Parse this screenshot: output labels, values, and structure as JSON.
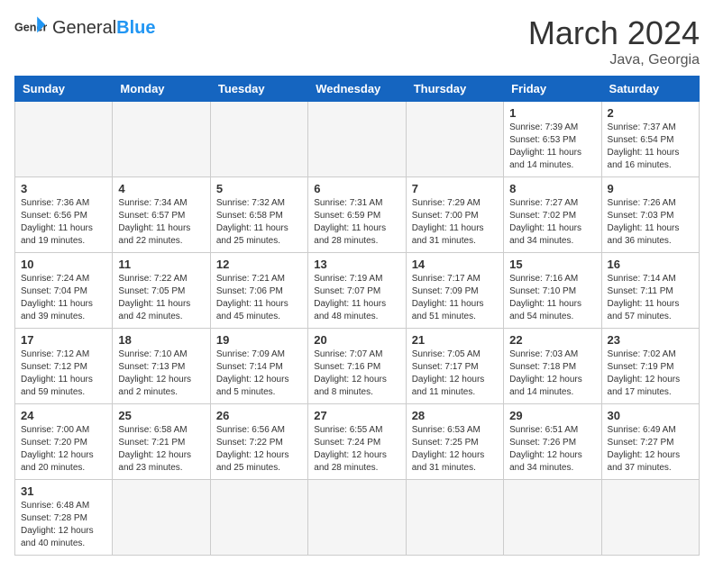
{
  "header": {
    "logo_general": "General",
    "logo_blue": "Blue",
    "title": "March 2024",
    "location": "Java, Georgia"
  },
  "days_of_week": [
    "Sunday",
    "Monday",
    "Tuesday",
    "Wednesday",
    "Thursday",
    "Friday",
    "Saturday"
  ],
  "weeks": [
    [
      {
        "day": "",
        "info": ""
      },
      {
        "day": "",
        "info": ""
      },
      {
        "day": "",
        "info": ""
      },
      {
        "day": "",
        "info": ""
      },
      {
        "day": "",
        "info": ""
      },
      {
        "day": "1",
        "info": "Sunrise: 7:39 AM\nSunset: 6:53 PM\nDaylight: 11 hours and 14 minutes."
      },
      {
        "day": "2",
        "info": "Sunrise: 7:37 AM\nSunset: 6:54 PM\nDaylight: 11 hours and 16 minutes."
      }
    ],
    [
      {
        "day": "3",
        "info": "Sunrise: 7:36 AM\nSunset: 6:56 PM\nDaylight: 11 hours and 19 minutes."
      },
      {
        "day": "4",
        "info": "Sunrise: 7:34 AM\nSunset: 6:57 PM\nDaylight: 11 hours and 22 minutes."
      },
      {
        "day": "5",
        "info": "Sunrise: 7:32 AM\nSunset: 6:58 PM\nDaylight: 11 hours and 25 minutes."
      },
      {
        "day": "6",
        "info": "Sunrise: 7:31 AM\nSunset: 6:59 PM\nDaylight: 11 hours and 28 minutes."
      },
      {
        "day": "7",
        "info": "Sunrise: 7:29 AM\nSunset: 7:00 PM\nDaylight: 11 hours and 31 minutes."
      },
      {
        "day": "8",
        "info": "Sunrise: 7:27 AM\nSunset: 7:02 PM\nDaylight: 11 hours and 34 minutes."
      },
      {
        "day": "9",
        "info": "Sunrise: 7:26 AM\nSunset: 7:03 PM\nDaylight: 11 hours and 36 minutes."
      }
    ],
    [
      {
        "day": "10",
        "info": "Sunrise: 7:24 AM\nSunset: 7:04 PM\nDaylight: 11 hours and 39 minutes."
      },
      {
        "day": "11",
        "info": "Sunrise: 7:22 AM\nSunset: 7:05 PM\nDaylight: 11 hours and 42 minutes."
      },
      {
        "day": "12",
        "info": "Sunrise: 7:21 AM\nSunset: 7:06 PM\nDaylight: 11 hours and 45 minutes."
      },
      {
        "day": "13",
        "info": "Sunrise: 7:19 AM\nSunset: 7:07 PM\nDaylight: 11 hours and 48 minutes."
      },
      {
        "day": "14",
        "info": "Sunrise: 7:17 AM\nSunset: 7:09 PM\nDaylight: 11 hours and 51 minutes."
      },
      {
        "day": "15",
        "info": "Sunrise: 7:16 AM\nSunset: 7:10 PM\nDaylight: 11 hours and 54 minutes."
      },
      {
        "day": "16",
        "info": "Sunrise: 7:14 AM\nSunset: 7:11 PM\nDaylight: 11 hours and 57 minutes."
      }
    ],
    [
      {
        "day": "17",
        "info": "Sunrise: 7:12 AM\nSunset: 7:12 PM\nDaylight: 11 hours and 59 minutes."
      },
      {
        "day": "18",
        "info": "Sunrise: 7:10 AM\nSunset: 7:13 PM\nDaylight: 12 hours and 2 minutes."
      },
      {
        "day": "19",
        "info": "Sunrise: 7:09 AM\nSunset: 7:14 PM\nDaylight: 12 hours and 5 minutes."
      },
      {
        "day": "20",
        "info": "Sunrise: 7:07 AM\nSunset: 7:16 PM\nDaylight: 12 hours and 8 minutes."
      },
      {
        "day": "21",
        "info": "Sunrise: 7:05 AM\nSunset: 7:17 PM\nDaylight: 12 hours and 11 minutes."
      },
      {
        "day": "22",
        "info": "Sunrise: 7:03 AM\nSunset: 7:18 PM\nDaylight: 12 hours and 14 minutes."
      },
      {
        "day": "23",
        "info": "Sunrise: 7:02 AM\nSunset: 7:19 PM\nDaylight: 12 hours and 17 minutes."
      }
    ],
    [
      {
        "day": "24",
        "info": "Sunrise: 7:00 AM\nSunset: 7:20 PM\nDaylight: 12 hours and 20 minutes."
      },
      {
        "day": "25",
        "info": "Sunrise: 6:58 AM\nSunset: 7:21 PM\nDaylight: 12 hours and 23 minutes."
      },
      {
        "day": "26",
        "info": "Sunrise: 6:56 AM\nSunset: 7:22 PM\nDaylight: 12 hours and 25 minutes."
      },
      {
        "day": "27",
        "info": "Sunrise: 6:55 AM\nSunset: 7:24 PM\nDaylight: 12 hours and 28 minutes."
      },
      {
        "day": "28",
        "info": "Sunrise: 6:53 AM\nSunset: 7:25 PM\nDaylight: 12 hours and 31 minutes."
      },
      {
        "day": "29",
        "info": "Sunrise: 6:51 AM\nSunset: 7:26 PM\nDaylight: 12 hours and 34 minutes."
      },
      {
        "day": "30",
        "info": "Sunrise: 6:49 AM\nSunset: 7:27 PM\nDaylight: 12 hours and 37 minutes."
      }
    ],
    [
      {
        "day": "31",
        "info": "Sunrise: 6:48 AM\nSunset: 7:28 PM\nDaylight: 12 hours and 40 minutes."
      },
      {
        "day": "",
        "info": ""
      },
      {
        "day": "",
        "info": ""
      },
      {
        "day": "",
        "info": ""
      },
      {
        "day": "",
        "info": ""
      },
      {
        "day": "",
        "info": ""
      },
      {
        "day": "",
        "info": ""
      }
    ]
  ]
}
